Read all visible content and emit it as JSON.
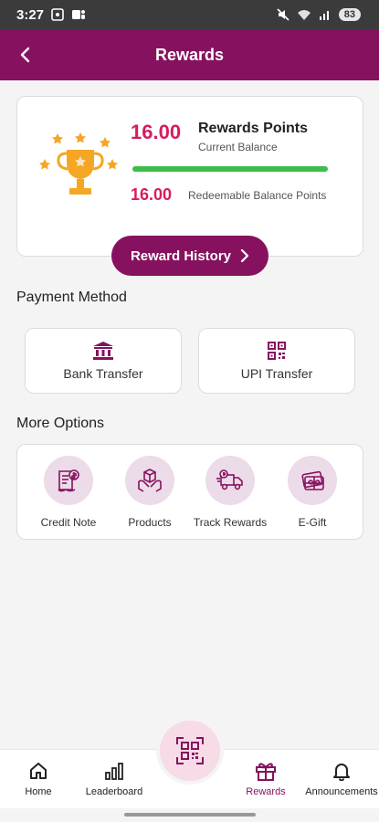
{
  "status_bar": {
    "time": "3:27",
    "battery": "83"
  },
  "header": {
    "title": "Rewards"
  },
  "balance": {
    "points": "16.00",
    "points_label": "Rewards Points",
    "points_sub": "Current Balance",
    "redeemable": "16.00",
    "redeemable_label": "Redeemable Balance Points",
    "progress_fraction": 1.0
  },
  "history_button": {
    "label": "Reward History"
  },
  "payment": {
    "title": "Payment Method",
    "options": [
      {
        "label": "Bank Transfer",
        "icon": "bank-icon"
      },
      {
        "label": "UPI Transfer",
        "icon": "qr-code-icon"
      }
    ]
  },
  "more_options": {
    "title": "More Options",
    "items": [
      {
        "label": "Credit Note",
        "icon": "credit-note-icon"
      },
      {
        "label": "Products",
        "icon": "products-icon"
      },
      {
        "label": "Track Rewards",
        "icon": "delivery-truck-icon"
      },
      {
        "label": "E-Gift",
        "icon": "gift-card-icon"
      }
    ]
  },
  "bottom_nav": {
    "items": [
      {
        "label": "Home",
        "icon": "home-icon"
      },
      {
        "label": "Leaderboard",
        "icon": "bar-chart-icon"
      },
      {
        "label": "Rewards",
        "icon": "gift-icon",
        "active": true
      },
      {
        "label": "Announcements",
        "icon": "bell-icon"
      }
    ],
    "scan_icon": "qr-scan-icon"
  },
  "colors": {
    "brand": "#86125f",
    "accent_red": "#d81b60",
    "progress_green": "#3dbe4c",
    "trophy_gold": "#f5a623"
  }
}
